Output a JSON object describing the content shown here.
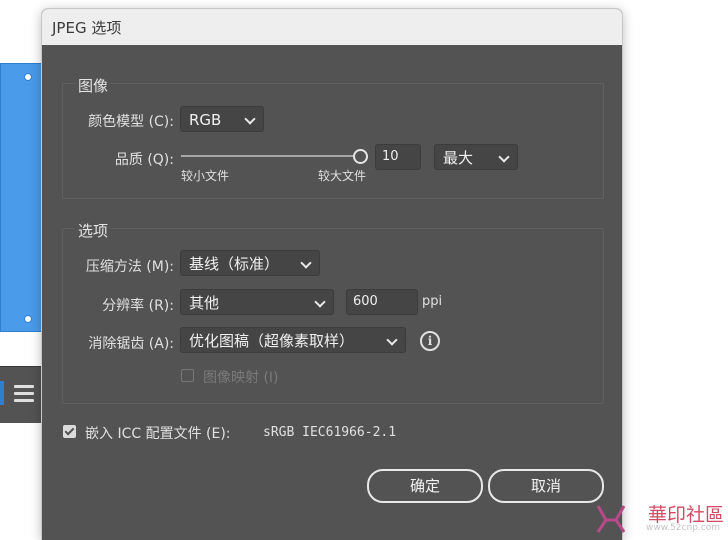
{
  "dialog": {
    "title": "JPEG 选项",
    "image_group": {
      "title": "图像",
      "color_model": {
        "label": "颜色模型 (C):",
        "value": "RGB"
      },
      "quality": {
        "label": "品质 (Q):",
        "value": "10",
        "level": 1.0,
        "preset": "最大",
        "min_label": "较小文件",
        "max_label": "较大文件"
      }
    },
    "options_group": {
      "title": "选项",
      "compression": {
        "label": "压缩方法 (M):",
        "value": "基线（标准）"
      },
      "resolution": {
        "label": "分辨率 (R):",
        "value": "其他",
        "ppi_value": "600",
        "unit": "ppi"
      },
      "antialiasing": {
        "label": "消除锯齿 (A):",
        "value": "优化图稿（超像素取样）"
      },
      "imagemap": {
        "label": "图像映射 (I)",
        "checked": false
      }
    },
    "embed_icc": {
      "label": "嵌入 ICC 配置文件 (E):",
      "profile": "sRGB IEC61966-2.1",
      "checked": true
    },
    "buttons": {
      "ok": "确定",
      "cancel": "取消"
    }
  },
  "watermark": {
    "text": "華印社區",
    "url": "www.52cnp.com"
  },
  "icons": {
    "info": "info-icon",
    "dropdown": "chevron-down-icon",
    "toolbar": "menu-icon"
  },
  "colors": {
    "dialog_bg": "#535353",
    "titlebar_bg": "#eeeeee",
    "accent_blue": "#4a9bea",
    "watermark_red": "#d24a63"
  }
}
